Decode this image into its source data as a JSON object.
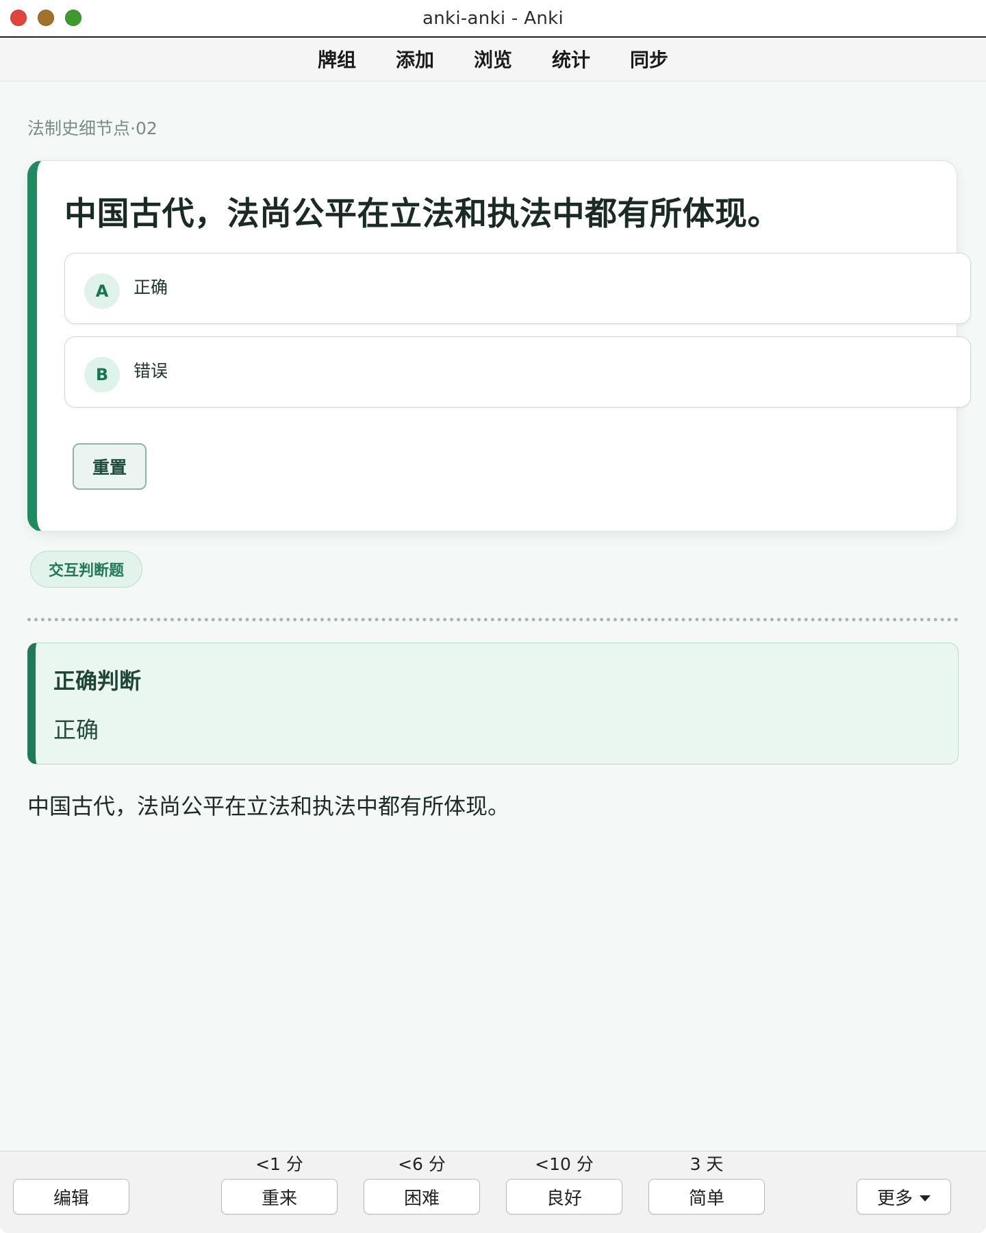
{
  "window": {
    "title": "anki-anki - Anki"
  },
  "toolbar": {
    "items": [
      "牌组",
      "添加",
      "浏览",
      "统计",
      "同步"
    ]
  },
  "deck": {
    "name": "法制史细节点·02"
  },
  "card": {
    "question": "中国古代，法尚公平在立法和执法中都有所体现。",
    "options": [
      {
        "letter": "A",
        "text": "正确"
      },
      {
        "letter": "B",
        "text": "错误"
      }
    ],
    "reset_label": "重置"
  },
  "tag": {
    "label": "交互判断题"
  },
  "answer": {
    "title": "正确判断",
    "value": "正确",
    "back_text": "中国古代，法尚公平在立法和执法中都有所体现。"
  },
  "bottombar": {
    "edit_label": "编辑",
    "more_label": "更多",
    "ease_buttons": [
      {
        "time": "<1 分",
        "label": "重来"
      },
      {
        "time": "<6 分",
        "label": "困难"
      },
      {
        "time": "<10 分",
        "label": "良好"
      },
      {
        "time": "3 天",
        "label": "简单"
      }
    ]
  },
  "colors": {
    "accent": "#1e8a62",
    "background": "#f4f8f7",
    "answer_bg": "#eaf6f0"
  }
}
